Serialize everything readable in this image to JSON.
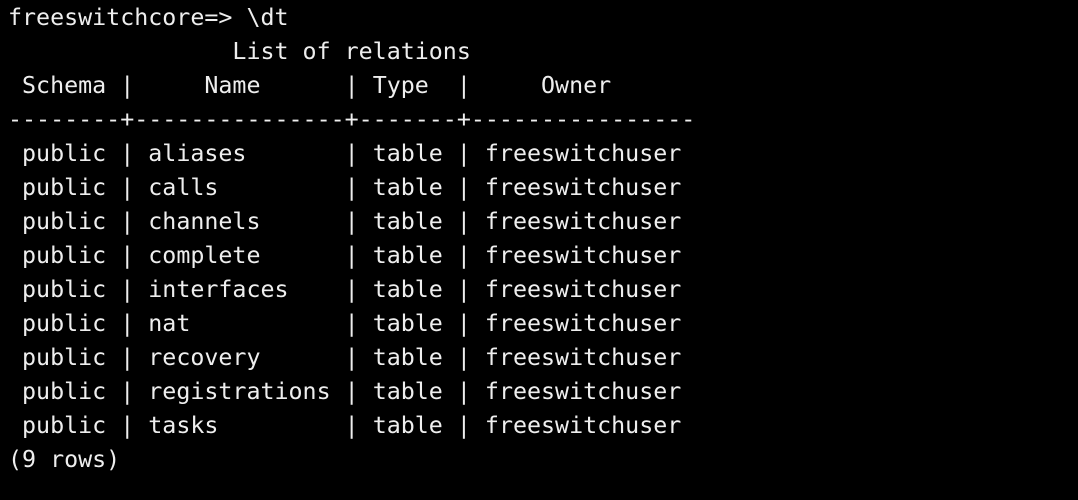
{
  "terminal": {
    "prompt": "freeswitchcore=> ",
    "command": "\\dt",
    "table_title": "List of relations",
    "headers": [
      "Schema",
      "Name",
      "Type",
      "Owner"
    ],
    "separator": "--------+---------------+-------+----------------",
    "rows": [
      {
        "schema": "public",
        "name": "aliases",
        "type": "table",
        "owner": "freeswitchuser"
      },
      {
        "schema": "public",
        "name": "calls",
        "type": "table",
        "owner": "freeswitchuser"
      },
      {
        "schema": "public",
        "name": "channels",
        "type": "table",
        "owner": "freeswitchuser"
      },
      {
        "schema": "public",
        "name": "complete",
        "type": "table",
        "owner": "freeswitchuser"
      },
      {
        "schema": "public",
        "name": "interfaces",
        "type": "table",
        "owner": "freeswitchuser"
      },
      {
        "schema": "public",
        "name": "nat",
        "type": "table",
        "owner": "freeswitchuser"
      },
      {
        "schema": "public",
        "name": "recovery",
        "type": "table",
        "owner": "freeswitchuser"
      },
      {
        "schema": "public",
        "name": "registrations",
        "type": "table",
        "owner": "freeswitchuser"
      },
      {
        "schema": "public",
        "name": "tasks",
        "type": "table",
        "owner": "freeswitchuser"
      }
    ],
    "footer": "(9 rows)"
  }
}
